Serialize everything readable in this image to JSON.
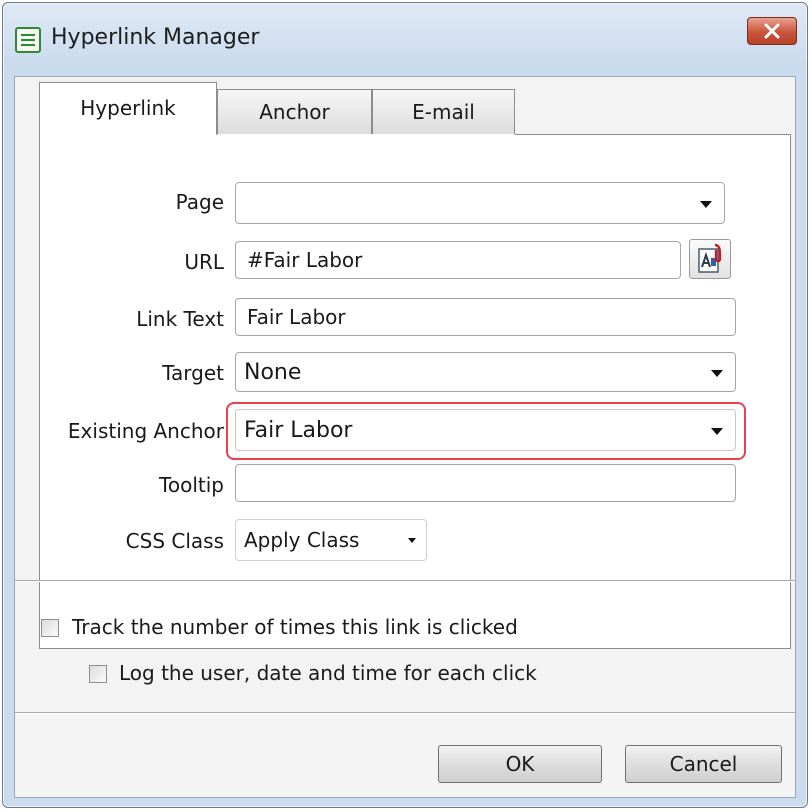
{
  "window": {
    "title": "Hyperlink Manager"
  },
  "icons": {
    "app": "document-lines-icon",
    "close": "close-x-icon",
    "browse": "document-clip-icon",
    "dropdown": "dropdown-caret-icon"
  },
  "tabs": [
    {
      "label": "Hyperlink",
      "active": true
    },
    {
      "label": "Anchor",
      "active": false
    },
    {
      "label": "E-mail",
      "active": false
    }
  ],
  "form": {
    "page": {
      "label": "Page",
      "value": ""
    },
    "url": {
      "label": "URL",
      "value": "#Fair Labor"
    },
    "link_text": {
      "label": "Link Text",
      "value": "Fair Labor"
    },
    "target": {
      "label": "Target",
      "value": "None"
    },
    "existing_anchor": {
      "label": "Existing Anchor",
      "value": "Fair Labor",
      "highlighted": true
    },
    "tooltip": {
      "label": "Tooltip",
      "value": ""
    },
    "css_class": {
      "label": "CSS Class",
      "value": "Apply Class"
    }
  },
  "options": {
    "track_clicks": {
      "label": "Track the number of times this link is clicked",
      "checked": false
    },
    "log_user": {
      "label": "Log the user, date and time for each click",
      "checked": false
    }
  },
  "buttons": {
    "ok": "OK",
    "cancel": "Cancel"
  },
  "colors": {
    "highlight": "#e8424a",
    "close_button": "#c9553c",
    "app_icon": "#2f8a2f"
  }
}
